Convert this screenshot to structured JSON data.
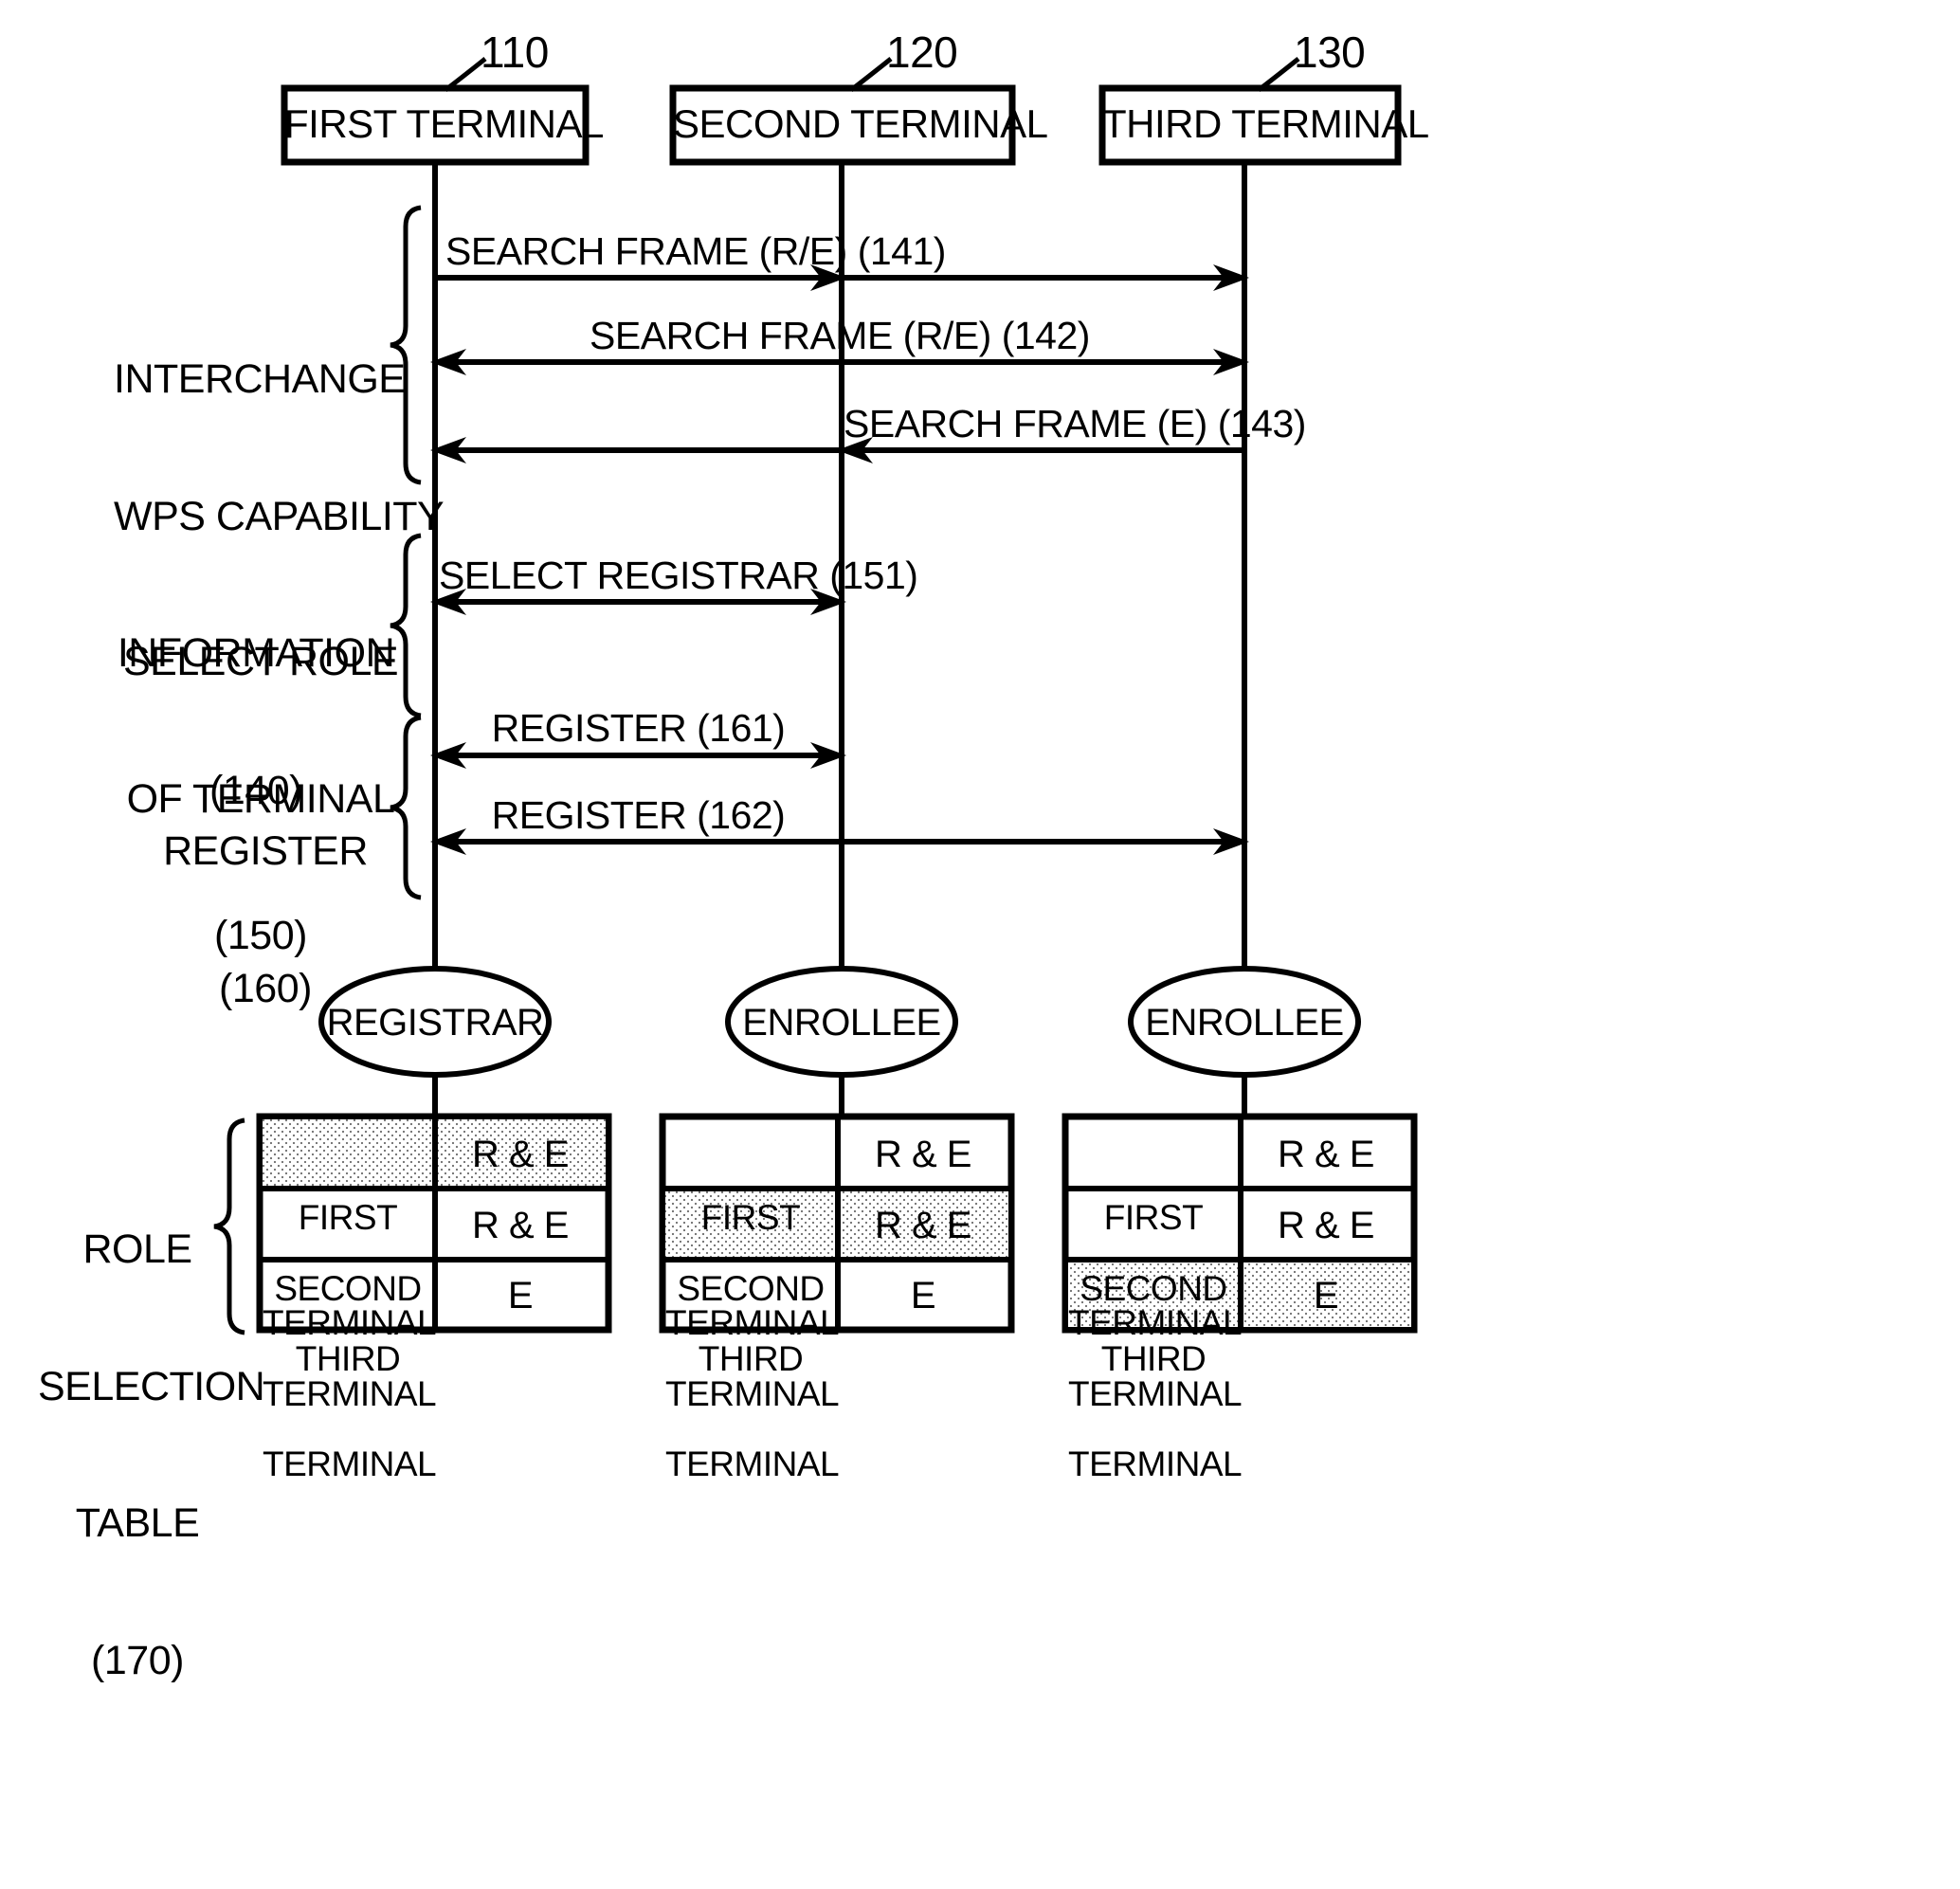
{
  "figure": {
    "type": "sequence-diagram",
    "terminals": [
      {
        "id": "110",
        "label": "FIRST TERMINAL",
        "ref": "110",
        "role": "REGISTRAR"
      },
      {
        "id": "120",
        "label": "SECOND TERMINAL",
        "ref": "120",
        "role": "ENROLLEE"
      },
      {
        "id": "130",
        "label": "THIRD TERMINAL",
        "ref": "130",
        "role": "ENROLLEE"
      }
    ],
    "phases": [
      {
        "ref": "140",
        "label_lines": [
          "INTERCHANGE",
          "WPS CAPABILITY",
          "INFORMATION",
          "(140)"
        ]
      },
      {
        "ref": "150",
        "label_lines": [
          "SELECT ROLE",
          "OF TERMINAL",
          "(150)"
        ]
      },
      {
        "ref": "160",
        "label_lines": [
          "REGISTER",
          "(160)"
        ]
      },
      {
        "ref": "170",
        "label_lines": [
          "ROLE",
          "SELECTION",
          "TABLE",
          "(170)"
        ]
      }
    ],
    "messages": [
      {
        "ref": "141",
        "label": "SEARCH FRAME (R/E) (141)",
        "from": "110",
        "to": "130",
        "direction": "right"
      },
      {
        "ref": "142",
        "label": "SEARCH FRAME (R/E) (142)",
        "from": "130",
        "to": "110",
        "direction": "both"
      },
      {
        "ref": "143",
        "label": "SEARCH FRAME (E) (143)",
        "from": "130",
        "to": "110",
        "direction": "left"
      },
      {
        "ref": "151",
        "label": "SELECT REGISTRAR (151)",
        "from": "110",
        "to": "120",
        "direction": "both"
      },
      {
        "ref": "161",
        "label": "REGISTER (161)",
        "from": "110",
        "to": "120",
        "direction": "both"
      },
      {
        "ref": "162",
        "label": "REGISTER (162)",
        "from": "110",
        "to": "130",
        "direction": "both"
      }
    ],
    "roles": [
      {
        "terminal": "110",
        "label": "REGISTRAR"
      },
      {
        "terminal": "120",
        "label": "ENROLLEE"
      },
      {
        "terminal": "130",
        "label": "ENROLLEE"
      }
    ],
    "role_selection_tables": [
      {
        "owner": "110",
        "rows": [
          {
            "name_line1": "FIRST",
            "name_line2": "TERMINAL",
            "value": "R & E",
            "highlighted": true
          },
          {
            "name_line1": "SECOND",
            "name_line2": "TERMINAL",
            "value": "R & E",
            "highlighted": false
          },
          {
            "name_line1": "THIRD",
            "name_line2": "TERMINAL",
            "value": "E",
            "highlighted": false
          }
        ]
      },
      {
        "owner": "120",
        "rows": [
          {
            "name_line1": "FIRST",
            "name_line2": "TERMINAL",
            "value": "R & E",
            "highlighted": false
          },
          {
            "name_line1": "SECOND",
            "name_line2": "TERMINAL",
            "value": "R & E",
            "highlighted": true
          },
          {
            "name_line1": "THIRD",
            "name_line2": "TERMINAL",
            "value": "E",
            "highlighted": false
          }
        ]
      },
      {
        "owner": "130",
        "rows": [
          {
            "name_line1": "FIRST",
            "name_line2": "TERMINAL",
            "value": "R & E",
            "highlighted": false
          },
          {
            "name_line1": "SECOND",
            "name_line2": "TERMINAL",
            "value": "R & E",
            "highlighted": false
          },
          {
            "name_line1": "THIRD",
            "name_line2": "TERMINAL",
            "value": "E",
            "highlighted": true
          }
        ]
      }
    ],
    "colors": {
      "stroke": "#000000",
      "background": "#ffffff",
      "highlight_fill": "#e8e8e8"
    }
  }
}
